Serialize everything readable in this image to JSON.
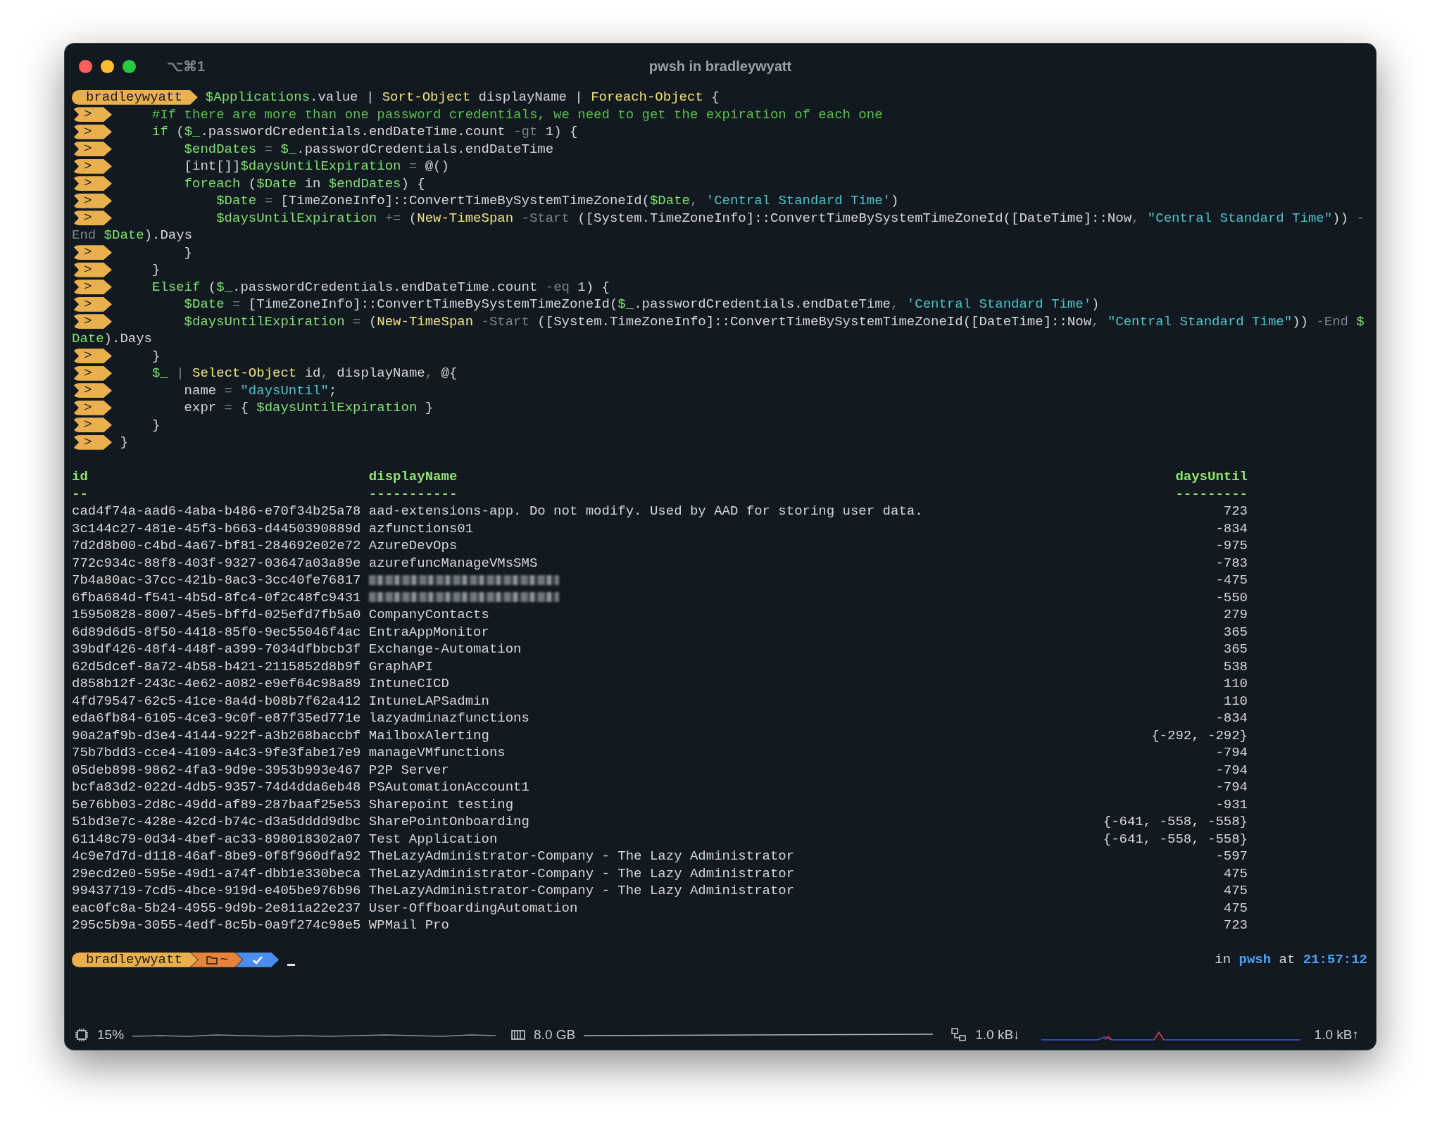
{
  "window": {
    "title": "pwsh in bradleywyatt",
    "shortcut": "⌥⌘1"
  },
  "code_lines": [
    {
      "kind": "user",
      "prompt": "bradleywyatt",
      "tokens": [
        {
          "kind": "variable",
          "text": "$Applications"
        },
        {
          "kind": "plain",
          "text": ".value | "
        },
        {
          "kind": "cmdlet",
          "text": "Sort-Object"
        },
        {
          "kind": "plain",
          "text": " displayName | "
        },
        {
          "kind": "cmdlet",
          "text": "Foreach-Object"
        },
        {
          "kind": "plain",
          "text": " {"
        }
      ]
    },
    {
      "kind": "continuation",
      "prompt": ">",
      "tokens": [
        {
          "kind": "comment",
          "text": "    #If there are more than one password credentials, we need to get the expiration of each one"
        }
      ]
    },
    {
      "kind": "continuation",
      "prompt": ">",
      "tokens": [
        {
          "kind": "keyword",
          "text": "    if"
        },
        {
          "kind": "plain",
          "text": " ("
        },
        {
          "kind": "variable",
          "text": "$_"
        },
        {
          "kind": "plain",
          "text": ".passwordCredentials.endDateTime.count "
        },
        {
          "kind": "operator",
          "text": "-gt"
        },
        {
          "kind": "plain",
          "text": " 1) {"
        }
      ]
    },
    {
      "kind": "continuation",
      "prompt": ">",
      "tokens": [
        {
          "kind": "variable",
          "text": "        $endDates"
        },
        {
          "kind": "operator",
          "text": " = "
        },
        {
          "kind": "variable",
          "text": "$_"
        },
        {
          "kind": "plain",
          "text": ".passwordCredentials.endDateTime"
        }
      ]
    },
    {
      "kind": "continuation",
      "prompt": ">",
      "tokens": [
        {
          "kind": "plain",
          "text": "        [int[]]"
        },
        {
          "kind": "variable",
          "text": "$daysUntilExpiration"
        },
        {
          "kind": "operator",
          "text": " = "
        },
        {
          "kind": "plain",
          "text": "@()"
        }
      ]
    },
    {
      "kind": "continuation",
      "prompt": ">",
      "tokens": [
        {
          "kind": "keyword",
          "text": "        foreach"
        },
        {
          "kind": "plain",
          "text": " ("
        },
        {
          "kind": "variable",
          "text": "$Date"
        },
        {
          "kind": "plain",
          "text": " in "
        },
        {
          "kind": "variable",
          "text": "$endDates"
        },
        {
          "kind": "plain",
          "text": ") {"
        }
      ]
    },
    {
      "kind": "continuation",
      "prompt": ">",
      "tokens": [
        {
          "kind": "variable",
          "text": "            $Date"
        },
        {
          "kind": "operator",
          "text": " = "
        },
        {
          "kind": "plain",
          "text": "[TimeZoneInfo]::ConvertTimeBySystemTimeZoneId("
        },
        {
          "kind": "variable",
          "text": "$Date"
        },
        {
          "kind": "operator",
          "text": ", "
        },
        {
          "kind": "string",
          "text": "'Central Standard Time'"
        },
        {
          "kind": "plain",
          "text": ")"
        }
      ]
    },
    {
      "kind": "continuation",
      "prompt": ">",
      "tokens": [
        {
          "kind": "variable",
          "text": "            $daysUntilExpiration"
        },
        {
          "kind": "operator",
          "text": " += "
        },
        {
          "kind": "plain",
          "text": "("
        },
        {
          "kind": "cmdlet",
          "text": "New-TimeSpan"
        },
        {
          "kind": "operator",
          "text": " -Start "
        },
        {
          "kind": "plain",
          "text": "([System.TimeZoneInfo]::ConvertTimeBySystemTimeZoneId([DateTime]::Now"
        },
        {
          "kind": "operator",
          "text": ", "
        },
        {
          "kind": "string",
          "text": "\"Central Standard Time\""
        },
        {
          "kind": "plain",
          "text": ")) "
        },
        {
          "kind": "operator",
          "text": "-"
        }
      ]
    },
    {
      "kind": "wrap",
      "tokens": [
        {
          "kind": "operator",
          "text": "End "
        },
        {
          "kind": "variable",
          "text": "$Date"
        },
        {
          "kind": "plain",
          "text": ").Days"
        }
      ]
    },
    {
      "kind": "continuation",
      "prompt": ">",
      "tokens": [
        {
          "kind": "plain",
          "text": "        }"
        }
      ]
    },
    {
      "kind": "continuation",
      "prompt": ">",
      "tokens": [
        {
          "kind": "plain",
          "text": "    }"
        }
      ]
    },
    {
      "kind": "continuation",
      "prompt": ">",
      "tokens": [
        {
          "kind": "keyword",
          "text": "    Elseif"
        },
        {
          "kind": "plain",
          "text": " ("
        },
        {
          "kind": "variable",
          "text": "$_"
        },
        {
          "kind": "plain",
          "text": ".passwordCredentials.endDateTime.count "
        },
        {
          "kind": "operator",
          "text": "-eq"
        },
        {
          "kind": "plain",
          "text": " 1) {"
        }
      ]
    },
    {
      "kind": "continuation",
      "prompt": ">",
      "tokens": [
        {
          "kind": "variable",
          "text": "        $Date"
        },
        {
          "kind": "operator",
          "text": " = "
        },
        {
          "kind": "plain",
          "text": "[TimeZoneInfo]::ConvertTimeBySystemTimeZoneId("
        },
        {
          "kind": "variable",
          "text": "$_"
        },
        {
          "kind": "plain",
          "text": ".passwordCredentials.endDateTime"
        },
        {
          "kind": "operator",
          "text": ", "
        },
        {
          "kind": "string",
          "text": "'Central Standard Time'"
        },
        {
          "kind": "plain",
          "text": ")"
        }
      ]
    },
    {
      "kind": "continuation",
      "prompt": ">",
      "tokens": [
        {
          "kind": "variable",
          "text": "        $daysUntilExpiration"
        },
        {
          "kind": "operator",
          "text": " = "
        },
        {
          "kind": "plain",
          "text": "("
        },
        {
          "kind": "cmdlet",
          "text": "New-TimeSpan"
        },
        {
          "kind": "operator",
          "text": " -Start "
        },
        {
          "kind": "plain",
          "text": "([System.TimeZoneInfo]::ConvertTimeBySystemTimeZoneId([DateTime]::Now"
        },
        {
          "kind": "operator",
          "text": ", "
        },
        {
          "kind": "string",
          "text": "\"Central Standard Time\""
        },
        {
          "kind": "plain",
          "text": ")) "
        },
        {
          "kind": "operator",
          "text": "-End "
        },
        {
          "kind": "variable",
          "text": "$"
        }
      ]
    },
    {
      "kind": "wrap",
      "tokens": [
        {
          "kind": "variable",
          "text": "Date"
        },
        {
          "kind": "plain",
          "text": ").Days"
        }
      ]
    },
    {
      "kind": "continuation",
      "prompt": ">",
      "tokens": [
        {
          "kind": "plain",
          "text": "    }"
        }
      ]
    },
    {
      "kind": "continuation",
      "prompt": ">",
      "tokens": [
        {
          "kind": "variable",
          "text": "    $_"
        },
        {
          "kind": "operator",
          "text": " | "
        },
        {
          "kind": "cmdlet",
          "text": "Select-Object"
        },
        {
          "kind": "plain",
          "text": " id"
        },
        {
          "kind": "operator",
          "text": ", "
        },
        {
          "kind": "plain",
          "text": "displayName"
        },
        {
          "kind": "operator",
          "text": ", "
        },
        {
          "kind": "plain",
          "text": "@{"
        }
      ]
    },
    {
      "kind": "continuation",
      "prompt": ">",
      "tokens": [
        {
          "kind": "plain",
          "text": "        name"
        },
        {
          "kind": "operator",
          "text": " = "
        },
        {
          "kind": "string",
          "text": "\"daysUntil\""
        },
        {
          "kind": "plain",
          "text": ";"
        }
      ]
    },
    {
      "kind": "continuation",
      "prompt": ">",
      "tokens": [
        {
          "kind": "plain",
          "text": "        expr"
        },
        {
          "kind": "operator",
          "text": " = "
        },
        {
          "kind": "plain",
          "text": "{ "
        },
        {
          "kind": "variable",
          "text": "$daysUntilExpiration"
        },
        {
          "kind": "plain",
          "text": " }"
        }
      ]
    },
    {
      "kind": "continuation",
      "prompt": ">",
      "tokens": [
        {
          "kind": "plain",
          "text": "    }"
        }
      ]
    },
    {
      "kind": "continuation",
      "prompt": ">",
      "tokens": [
        {
          "kind": "plain",
          "text": "}"
        }
      ]
    }
  ],
  "table": {
    "columns": [
      {
        "label": "id",
        "underline": "--"
      },
      {
        "label": "displayName",
        "underline": "-----------"
      },
      {
        "label": "daysUntil",
        "underline": "---------"
      }
    ],
    "rows": [
      {
        "id": "cad4f74a-aad6-4aba-b486-e70f34b25a78",
        "displayName": "aad-extensions-app. Do not modify. Used by AAD for storing user data.",
        "daysUntil": "723"
      },
      {
        "id": "3c144c27-481e-45f3-b663-d4450390889d",
        "displayName": "azfunctions01",
        "daysUntil": "-834"
      },
      {
        "id": "7d2d8b00-c4bd-4a67-bf81-284692e02e72",
        "displayName": "AzureDevOps",
        "daysUntil": "-975"
      },
      {
        "id": "772c934c-88f8-403f-9327-03647a03a89e",
        "displayName": "azurefuncManageVMsSMS",
        "daysUntil": "-783"
      },
      {
        "id": "7b4a80ac-37cc-421b-8ac3-3cc40fe76817",
        "redacted": true,
        "daysUntil": "-475"
      },
      {
        "id": "6fba684d-f541-4b5d-8fc4-0f2c48fc9431",
        "redacted": true,
        "daysUntil": "-550"
      },
      {
        "id": "15950828-8007-45e5-bffd-025efd7fb5a0",
        "displayName": "CompanyContacts",
        "daysUntil": "279"
      },
      {
        "id": "6d89d6d5-8f50-4418-85f0-9ec55046f4ac",
        "displayName": "EntraAppMonitor",
        "daysUntil": "365"
      },
      {
        "id": "39bdf426-48f4-448f-a399-7034dfbbcb3f",
        "displayName": "Exchange-Automation",
        "daysUntil": "365"
      },
      {
        "id": "62d5dcef-8a72-4b58-b421-2115852d8b9f",
        "displayName": "GraphAPI",
        "daysUntil": "538"
      },
      {
        "id": "d858b12f-243c-4e62-a082-e9ef64c98a89",
        "displayName": "IntuneCICD",
        "daysUntil": "110"
      },
      {
        "id": "4fd79547-62c5-41ce-8a4d-b08b7f62a412",
        "displayName": "IntuneLAPSadmin",
        "daysUntil": "110"
      },
      {
        "id": "eda6fb84-6105-4ce3-9c0f-e87f35ed771e",
        "displayName": "lazyadminazfunctions",
        "daysUntil": "-834"
      },
      {
        "id": "90a2af9b-d3e4-4144-922f-a3b268baccbf",
        "displayName": "MailboxAlerting",
        "daysUntil": "{-292, -292}"
      },
      {
        "id": "75b7bdd3-cce4-4109-a4c3-9fe3fabe17e9",
        "displayName": "manageVMfunctions",
        "daysUntil": "-794"
      },
      {
        "id": "05deb898-9862-4fa3-9d9e-3953b993e467",
        "displayName": "P2P Server",
        "daysUntil": "-794"
      },
      {
        "id": "bcfa83d2-022d-4db5-9357-74d4dda6eb48",
        "displayName": "PSAutomationAccount1",
        "daysUntil": "-794"
      },
      {
        "id": "5e76bb03-2d8c-49dd-af89-287baaf25e53",
        "displayName": "Sharepoint testing",
        "daysUntil": "-931"
      },
      {
        "id": "51bd3e7c-428e-42cd-b74c-d3a5dddd9dbc",
        "displayName": "SharePointOnboarding",
        "daysUntil": "{-641, -558, -558}"
      },
      {
        "id": "61148c79-0d34-4bef-ac33-898018302a07",
        "displayName": "Test Application",
        "daysUntil": "{-641, -558, -558}"
      },
      {
        "id": "4c9e7d7d-d118-46af-8be9-0f8f960dfa92",
        "displayName": "TheLazyAdministrator-Company - The Lazy Administrator",
        "daysUntil": "-597"
      },
      {
        "id": "29ecd2e0-595e-49d1-a74f-dbb1e330beca",
        "displayName": "TheLazyAdministrator-Company - The Lazy Administrator",
        "daysUntil": "475"
      },
      {
        "id": "99437719-7cd5-4bce-919d-e405be976b96",
        "displayName": "TheLazyAdministrator-Company - The Lazy Administrator",
        "daysUntil": "475"
      },
      {
        "id": "eac0fc8a-5b24-4955-9d9b-2e811a22e237",
        "displayName": "User-OffboardingAutomation",
        "daysUntil": "475"
      },
      {
        "id": "295c5b9a-3055-4edf-8c5b-0a9f274c98e5",
        "displayName": "WPMail Pro",
        "daysUntil": "723"
      }
    ]
  },
  "prompt": {
    "user": "bradleywyatt",
    "directory": "~",
    "right": {
      "prefix": "in",
      "shell": "pwsh",
      "separator": "at",
      "time": "21:57:12"
    }
  },
  "status_bar": {
    "cpu": "15%",
    "memory": "8.0 GB",
    "download": "1.0 kB↓",
    "upload": "1.0 kB↑"
  }
}
